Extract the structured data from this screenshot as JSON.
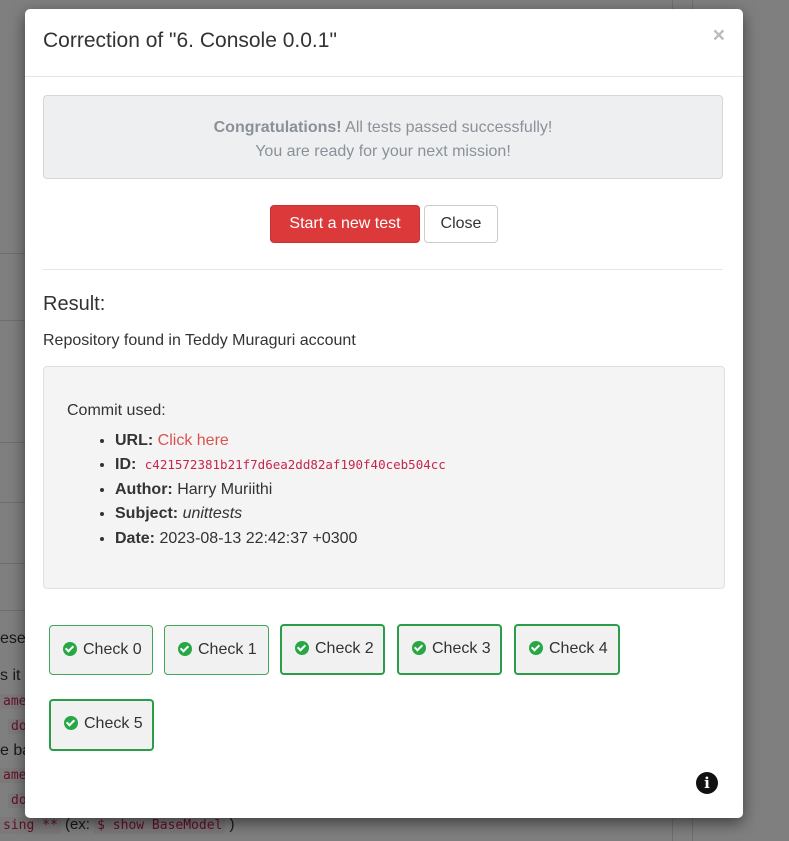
{
  "background": {
    "fragments": [
      "ese",
      "s it",
      "ame",
      "do",
      "e ba",
      "ame",
      "do"
    ],
    "bottom_text": {
      "code1": "sing **",
      "text": " (ex: ",
      "code2": "$ show BaseModel",
      "end": " )"
    }
  },
  "modal": {
    "title": "Correction of \"6. Console 0.0.1\"",
    "close_symbol": "×",
    "alert": {
      "strong": "Congratulations!",
      "line1_rest": " All tests passed successfully!",
      "line2": "You are ready for your next mission!"
    },
    "buttons": {
      "start_new_test": "Start a new test",
      "close": "Close"
    },
    "result": {
      "title": "Result:",
      "repo_text": "Repository found in Teddy Muraguri account"
    },
    "commit": {
      "label": "Commit used:",
      "url_label": "URL:",
      "url_link_text": "Click here",
      "id_label": "ID:",
      "id_value": "c421572381b21f7d6ea2dd82af190f40ceb504cc",
      "author_label": "Author:",
      "author_value": "Harry Muriithi",
      "subject_label": "Subject:",
      "subject_value": "unittests",
      "date_label": "Date:",
      "date_value": "2023-08-13 22:42:37 +0300"
    },
    "checks": [
      {
        "label": "Check 0",
        "status": "passed",
        "selected": false
      },
      {
        "label": "Check 1",
        "status": "passed",
        "selected": false
      },
      {
        "label": "Check 2",
        "status": "passed",
        "selected": true
      },
      {
        "label": "Check 3",
        "status": "passed",
        "selected": true
      },
      {
        "label": "Check 4",
        "status": "passed",
        "selected": true
      },
      {
        "label": "Check 5",
        "status": "passed",
        "selected": true
      }
    ],
    "info_symbol": "i",
    "colors": {
      "danger": "#dc3a3a",
      "success": "#28a745",
      "link": "#d9534f",
      "code": "#c7254e"
    }
  }
}
